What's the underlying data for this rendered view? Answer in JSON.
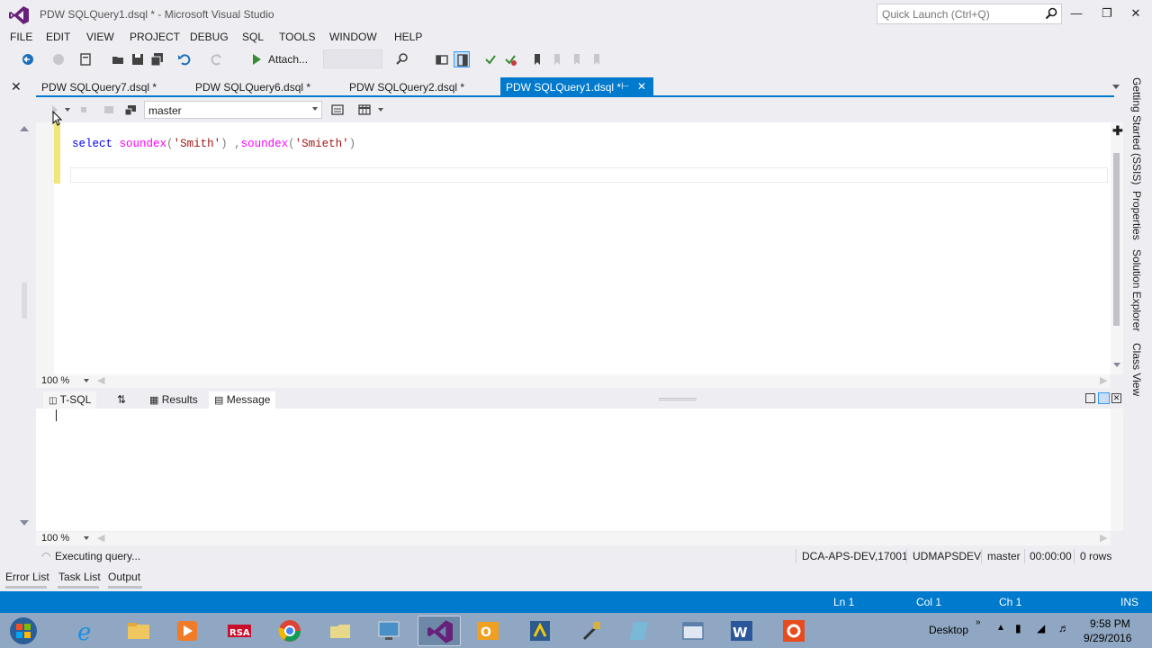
{
  "window": {
    "title": "PDW SQLQuery1.dsql * - Microsoft Visual Studio",
    "quick_launch_placeholder": "Quick Launch (Ctrl+Q)"
  },
  "menu": [
    "FILE",
    "EDIT",
    "VIEW",
    "PROJECT",
    "DEBUG",
    "SQL",
    "TOOLS",
    "WINDOW",
    "HELP"
  ],
  "toolbar": {
    "attach_label": "Attach..."
  },
  "doc_tabs": [
    {
      "label": "PDW SQLQuery7.dsql *"
    },
    {
      "label": "PDW SQLQuery6.dsql *"
    },
    {
      "label": "PDW SQLQuery2.dsql *"
    },
    {
      "label": "PDW SQLQuery1.dsql *",
      "active": true
    }
  ],
  "query_toolbar": {
    "database": "master"
  },
  "editor": {
    "code": {
      "kw": "select",
      "fn1": "soundex",
      "p1": "(",
      "s1": "'Smith'",
      "p2": ") ,",
      "fn2": "soundex",
      "p3": "(",
      "s2": "'Smieth'",
      "p4": ")"
    },
    "zoom": "100 %"
  },
  "results": {
    "tabs": [
      "T-SQL",
      "Results",
      "Message"
    ],
    "selected_tab": "Message",
    "zoom": "100 %"
  },
  "query_status": {
    "message": "Executing query...",
    "server": "DCA-APS-DEV,17001",
    "login": "UDMAPSDEV",
    "database": "master",
    "elapsed": "00:00:00",
    "rows": "0 rows"
  },
  "bottom_tabs": [
    "Error List",
    "Task List",
    "Output"
  ],
  "status_bar": {
    "ln": "Ln 1",
    "col": "Col 1",
    "ch": "Ch 1",
    "mode": "INS"
  },
  "side_panel": [
    "Getting Started (SSIS)",
    "Properties",
    "Solution Explorer",
    "Class View"
  ],
  "taskbar": {
    "desktop_label": "Desktop",
    "time": "9:58 PM",
    "date": "9/29/2016",
    "apps": [
      "internet-explorer",
      "file-explorer",
      "media-player",
      "rsa",
      "chrome",
      "folder",
      "remote-desktop",
      "visual-studio",
      "outlook",
      "power-bi",
      "tools",
      "editor",
      "window",
      "word",
      "office"
    ]
  },
  "colors": {
    "accent": "#007acc",
    "taskbar": "#8fa7c2",
    "keyword": "#0000ff",
    "function": "#ff00ff",
    "string": "#a31515"
  }
}
